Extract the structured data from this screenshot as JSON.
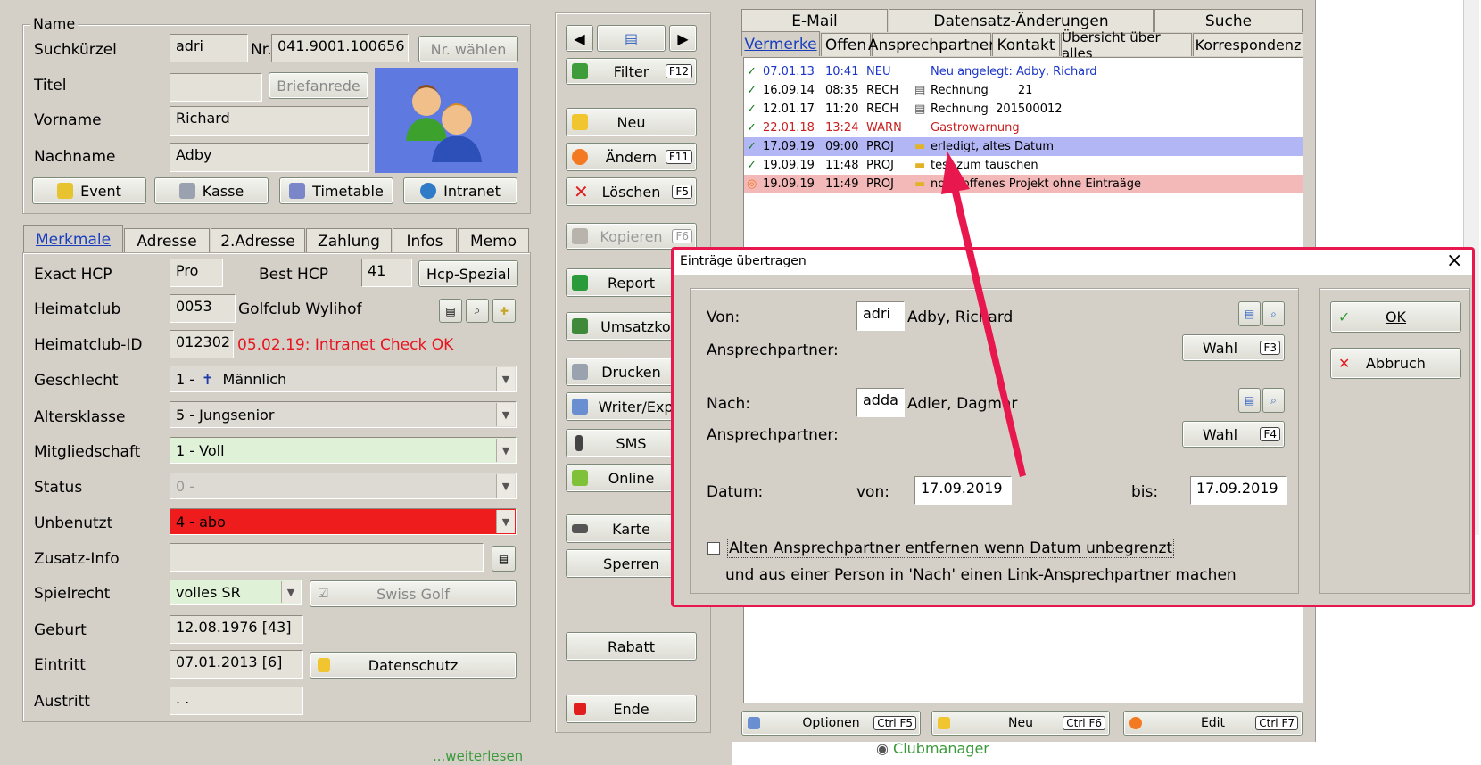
{
  "name_section": {
    "group_label": "Name",
    "suchkuerzel_label": "Suchkürzel",
    "suchkuerzel_value": "adri",
    "nr_label": "Nr.",
    "nr_value": "041.9001.100656",
    "nr_waehlen_label": "Nr. wählen",
    "titel_label": "Titel",
    "titel_value": "",
    "briefanrede_label": "Briefanrede",
    "vorname_label": "Vorname",
    "vorname_value": "Richard",
    "nachname_label": "Nachname",
    "nachname_value": "Adby",
    "buttons": {
      "event": "Event",
      "kasse": "Kasse",
      "timetable": "Timetable",
      "intranet": "Intranet"
    }
  },
  "tabs": [
    "Merkmale",
    "Adresse",
    "2.Adresse",
    "Zahlung",
    "Infos",
    "Memo"
  ],
  "merkmale": {
    "exact_hcp_label": "Exact HCP",
    "exact_hcp_value": "Pro",
    "best_hcp_label": "Best HCP",
    "best_hcp_value": "41",
    "hcp_spezial_label": "Hcp-Spezial",
    "heimatclub_label": "Heimatclub",
    "heimatclub_code": "0053",
    "heimatclub_name": "Golfclub Wylihof",
    "heimatclub_id_label": "Heimatclub-ID",
    "heimatclub_id_value": "012302",
    "intranet_check": "05.02.19: Intranet Check OK",
    "geschlecht_label": "Geschlecht",
    "geschlecht_value": "1 -",
    "geschlecht_text": "Männlich",
    "altersklasse_label": "Altersklasse",
    "altersklasse_value": "5 - Jungsenior",
    "mitgliedschaft_label": "Mitgliedschaft",
    "mitgliedschaft_value": "1 - Voll",
    "status_label": "Status",
    "status_value": "0 -",
    "unbenutzt_label": "Unbenutzt",
    "unbenutzt_value": "4 - abo",
    "zusatz_info_label": "Zusatz-Info",
    "zusatz_info_value": "",
    "spielrecht_label": "Spielrecht",
    "spielrecht_value": "volles SR",
    "swiss_golf_label": "Swiss Golf",
    "geburt_label": "Geburt",
    "geburt_value": "12.08.1976  [43]",
    "eintritt_label": "Eintritt",
    "eintritt_value": "07.01.2013  [6]",
    "datenschutz_label": "Datenschutz",
    "austritt_label": "Austritt",
    "austritt_value": " .  ."
  },
  "action_buttons": {
    "filter": "Filter",
    "filter_key": "F12",
    "neu": "Neu",
    "aendern": "Ändern",
    "aendern_key": "F11",
    "loeschen": "Löschen",
    "loeschen_key": "F5",
    "kopieren": "Kopieren",
    "kopieren_key": "F6",
    "report": "Report",
    "umsatzkonto": "Umsatzkon",
    "drucken": "Drucken",
    "writer": "Writer/Expo",
    "sms": "SMS",
    "online": "Online",
    "karte": "Karte",
    "sperren": "Sperren",
    "rabatt": "Rabatt",
    "ende": "Ende"
  },
  "right_tabs_top": [
    "E-Mail",
    "Datensatz-Änderungen",
    "Suche"
  ],
  "right_tabs_bottom": [
    "Vermerke",
    "Offen",
    "Ansprechpartner",
    "Kontakt",
    "Übersicht über alles",
    "Korrespondenz"
  ],
  "notes": [
    {
      "date": "07.01.13",
      "time": "10:41",
      "type": "NEU",
      "text": "Neu angelegt: Adby, Richard",
      "color": "#1a35c8"
    },
    {
      "date": "16.09.14",
      "time": "08:35",
      "type": "RECH",
      "text": "Rechnung        21",
      "color": "#000000"
    },
    {
      "date": "12.01.17",
      "time": "11:20",
      "type": "RECH",
      "text": "Rechnung  201500012",
      "color": "#000000"
    },
    {
      "date": "22.01.18",
      "time": "13:24",
      "type": "WARN",
      "text": "Gastrowarnung",
      "color": "#c81e1e"
    },
    {
      "date": "17.09.19",
      "time": "09:00",
      "type": "PROJ",
      "text": "erledigt, altes Datum",
      "color": "#000000"
    },
    {
      "date": "19.09.19",
      "time": "11:48",
      "type": "PROJ",
      "text": "test zum tauschen",
      "color": "#000000"
    },
    {
      "date": "19.09.19",
      "time": "11:49",
      "type": "PROJ",
      "text": "noch offenes Projekt ohne Eintraäge",
      "color": "#000000"
    }
  ],
  "bottom_buttons": {
    "optionen": "Optionen",
    "optionen_key": "F5",
    "neu": "Neu",
    "neu_key": "F6",
    "edit": "Edit",
    "edit_key": "F7"
  },
  "footer": {
    "weiterlesen": "...weiterlesen",
    "clubmanager": "Clubmanager"
  },
  "dialog": {
    "title": "Einträge übertragen",
    "close": "×",
    "von_label": "Von:",
    "von_value": "adri",
    "von_name": "Adby, Richard",
    "ansprech1_label": "Ansprechpartner:",
    "wahl1_label": "Wahl",
    "wahl1_key": "F3",
    "nach_label": "Nach:",
    "nach_value": "adda",
    "nach_name": "Adler, Dagmar",
    "ansprech2_label": "Ansprechpartner:",
    "wahl2_label": "Wahl",
    "wahl2_key": "F4",
    "datum_label": "Datum:",
    "von_date_label": "von:",
    "von_date_value": "17.09.2019",
    "bis_label": "bis:",
    "bis_value": "17.09.2019",
    "checkbox_label": "Alten Ansprechpartner entfernen wenn Datum unbegrenzt",
    "checkbox_sub": "und aus einer Person in 'Nach' einen Link-Ansprechpartner machen",
    "ok_label": "OK",
    "abbruch_label": "Abbruch"
  },
  "colors": {
    "annotation": "#e8174e",
    "accent_blue": "#1a3fbd",
    "panel": "#d4d0c8"
  }
}
